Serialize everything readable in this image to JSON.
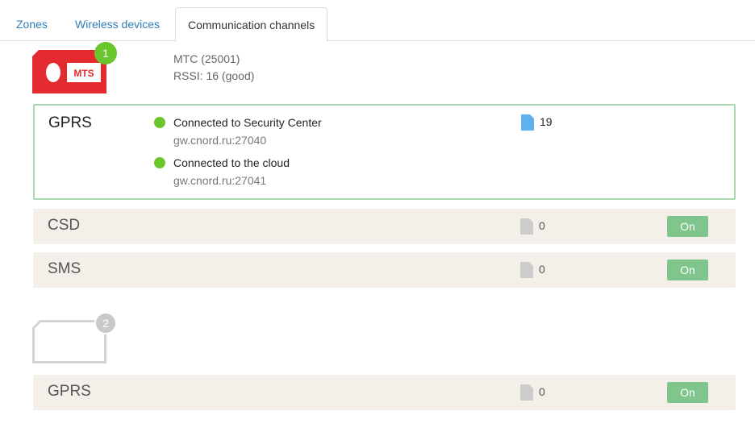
{
  "tabs": [
    {
      "label": "Zones"
    },
    {
      "label": "Wireless devices"
    },
    {
      "label": "Communication channels"
    }
  ],
  "sim1": {
    "badge": "1",
    "logo_text": "MTS",
    "operator": "MTC (25001)",
    "rssi": "RSSI: 16 (good)",
    "brand_color": "#e32a2e"
  },
  "gprs_active": {
    "name": "GPRS",
    "connections": [
      {
        "title": "Connected to Security Center",
        "address": "gw.cnord.ru:27040",
        "status_color": "#6ac72b"
      },
      {
        "title": "Connected to the cloud",
        "address": "gw.cnord.ru:27041",
        "status_color": "#6ac72b"
      }
    ],
    "doc_count": "19"
  },
  "csd": {
    "name": "CSD",
    "doc_count": "0",
    "toggle": "On"
  },
  "sms": {
    "name": "SMS",
    "doc_count": "0",
    "toggle": "On"
  },
  "sim2": {
    "badge": "2"
  },
  "gprs2": {
    "name": "GPRS",
    "doc_count": "0",
    "toggle": "On"
  },
  "colors": {
    "accent": "#2f7fb8",
    "on_button": "#7ec68b",
    "active_border": "#a9d8b1",
    "row_bg": "#f4efe9"
  }
}
